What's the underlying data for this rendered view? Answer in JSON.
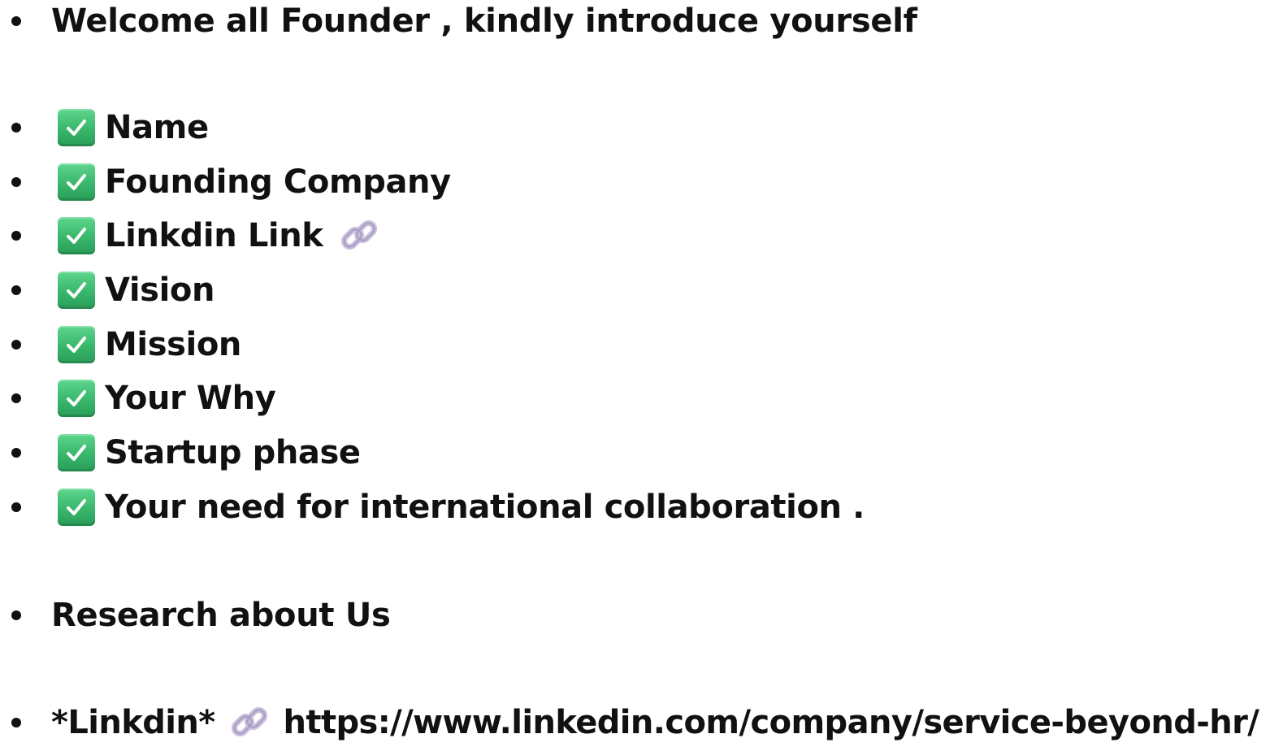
{
  "intro": {
    "text": "Welcome all Founder , kindly introduce yourself"
  },
  "checklist": {
    "check_icon": "check-mark-button-icon",
    "check_color": "#38b76b",
    "items": [
      {
        "label": "Name"
      },
      {
        "label": "Founding Company"
      },
      {
        "label": "Linkdin Link",
        "trailing_icon": "link-icon"
      },
      {
        "label": "Vision"
      },
      {
        "label": "Mission"
      },
      {
        "label": "Your Why"
      },
      {
        "label": "Startup phase"
      },
      {
        "label": "Your need for international collaboration ."
      }
    ]
  },
  "research": {
    "text": "Research about Us"
  },
  "linkedin": {
    "label": "*Linkdin*",
    "icon": "link-icon",
    "icon_color": "#c9bfdc",
    "url": "https://www.linkedin.com/company/service-beyond-hr/"
  }
}
